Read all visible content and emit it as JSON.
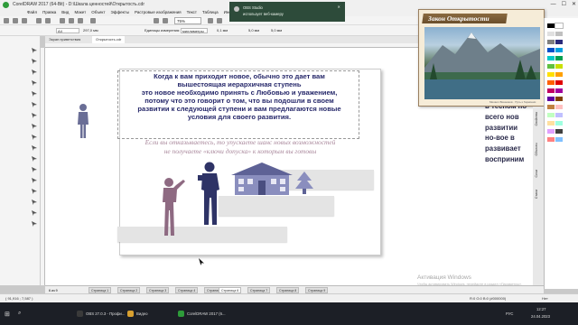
{
  "window": {
    "title": "CorelDRAW 2017 (64-Bit) - D:\\Шкала ценностей\\Открытость.cdr",
    "controls": [
      "—",
      "☐",
      "✕"
    ]
  },
  "menu": [
    "Файл",
    "Правка",
    "Вид",
    "Макет",
    "Объект",
    "Эффекты",
    "Растровые изображения",
    "Текст",
    "Таблица",
    "Инструменты",
    "Окно",
    "Справка"
  ],
  "toolbar": {
    "zoom": "75%",
    "page_size": "A4",
    "x_value": "297,0 мм",
    "y_value": "210,0 мм",
    "units_label": "Единицы измерения:",
    "units_value": "миллиметры",
    "nudge": "0,1 мм",
    "dup_x": "5,0 мм",
    "dup_y": "5,0 мм"
  },
  "doc_tabs": {
    "welcome": "Экран приветствия",
    "document": "Открытость.cdr"
  },
  "notification": {
    "app": "OBS Studio",
    "message": "использует веб-камеру",
    "close": "✕"
  },
  "canvas": {
    "main_text": [
      "Когда к вам приходит новое, обычно это дает вам",
      "вышестоящая иерархичная ступень",
      "это новое необходимо принять с Любовью и уважением,",
      "потому что это говорит о том, что вы подошли в своем",
      "развитии к следующей ступени и вам предлагаются новые",
      "условия для своего развития."
    ],
    "italic_text": [
      "Если вы отказываетесь, то упускаете шанс новых возможностей",
      "не получаете «ключи допуска» к которым вы готовы"
    ],
    "side_text": [
      "в тесном по",
      "всего нов",
      "развитии",
      "но-вое в",
      "развивает",
      "восприним"
    ]
  },
  "popup": {
    "title": "Закон Открытости",
    "caption": "Михаил Вишняков · Путь к Гармонии"
  },
  "docker_labels": [
    "Свойства",
    "Объекты",
    "Слои",
    "Стили"
  ],
  "palette_colors": [
    "#000000",
    "#ffffff",
    "#e0e0e0",
    "#c0c0c0",
    "#808080",
    "#2a2a7a",
    "#0050c8",
    "#00a0e0",
    "#00c8c8",
    "#00a050",
    "#60c040",
    "#c8e000",
    "#ffe000",
    "#ffa000",
    "#ff6000",
    "#e00000",
    "#c00060",
    "#a000a0",
    "#6000a0",
    "#804000",
    "#c08040",
    "#ffc0c0",
    "#c0ffc0",
    "#c0c0ff",
    "#ffe0a0",
    "#a0ffe0",
    "#e0a0ff",
    "#404040",
    "#ff8080",
    "#80c0ff"
  ],
  "page_tabs": {
    "counter": "6 из 9",
    "items": [
      "Страница 1",
      "Страница 2",
      "Страница 3",
      "Страница 4",
      "Страница 5",
      "Страница 6",
      "Страница 7",
      "Страница 8",
      "Страница 9"
    ],
    "active_index": 5
  },
  "statusbar": {
    "coords": "( 91,916 ; 7,587 )",
    "color_info": "R:0 G:0 B:0 (#000000)",
    "none_label": "Нет"
  },
  "watermark": {
    "title": "Активация Windows",
    "subtitle": "Чтобы активировать Windows, перейдите в раздел «Параметры»."
  },
  "taskbar": {
    "apps": [
      {
        "label": "OBS 27.0.3 - Профи...",
        "color": "#3a3a3a"
      },
      {
        "label": "Видео",
        "color": "#d8a030"
      },
      {
        "label": "CorelDRAW 2017 (6...",
        "color": "#2e9b3a"
      }
    ],
    "lang": "РУС",
    "time": "12:27",
    "date": "24.04.2023"
  }
}
